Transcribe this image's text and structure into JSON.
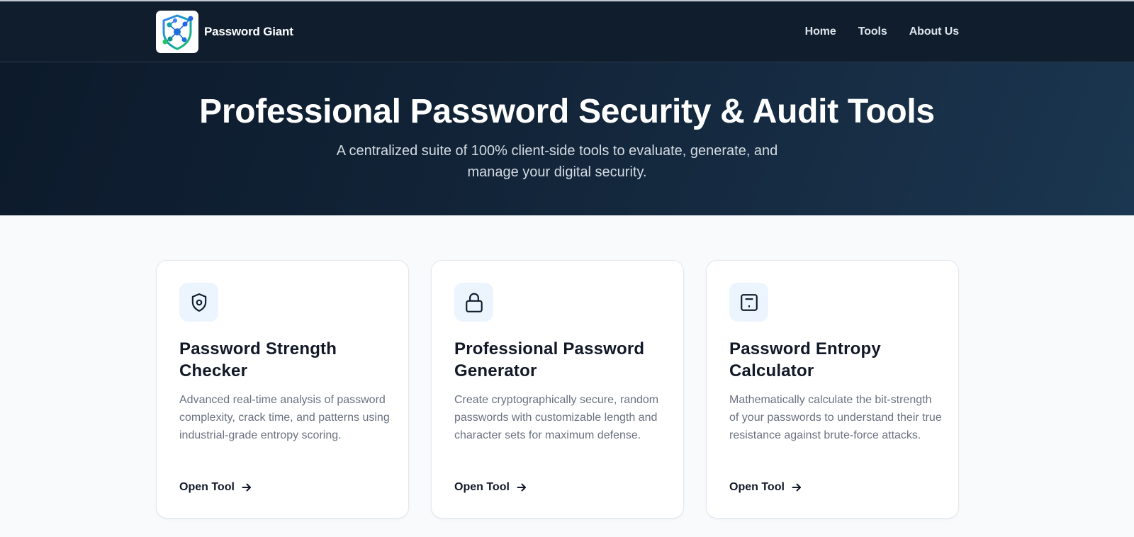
{
  "brand": {
    "name": "Password Giant"
  },
  "nav": {
    "items": [
      {
        "label": "Home"
      },
      {
        "label": "Tools"
      },
      {
        "label": "About Us"
      }
    ]
  },
  "hero": {
    "title": "Professional Password Security & Audit Tools",
    "subtitle": "A centralized suite of 100% client-side tools to evaluate, generate, and manage your digital security."
  },
  "tools": [
    {
      "icon": "shield-icon",
      "title": "Password Strength Checker",
      "description": "Advanced real-time analysis of password complexity, crack time, and patterns using industrial-grade entropy scoring.",
      "cta": "Open Tool"
    },
    {
      "icon": "lock-icon",
      "title": "Professional Password Generator",
      "description": "Create cryptographically secure, random passwords with customizable length and character sets for maximum defense.",
      "cta": "Open Tool"
    },
    {
      "icon": "calculator-icon",
      "title": "Password Entropy Calculator",
      "description": "Mathematically calculate the bit-strength of your passwords to understand their true resistance against brute-force attacks.",
      "cta": "Open Tool"
    }
  ],
  "colors": {
    "nav_bg": "#0f1d2d",
    "hero_bg_start": "#0c1a2b",
    "hero_bg_end": "#1b3650",
    "page_bg": "#f8fafc",
    "icon_tile_bg": "#ecf5fd",
    "logo_accent_blue": "#2563eb",
    "logo_accent_teal": "#0d9488",
    "logo_accent_green": "#22c55e"
  }
}
